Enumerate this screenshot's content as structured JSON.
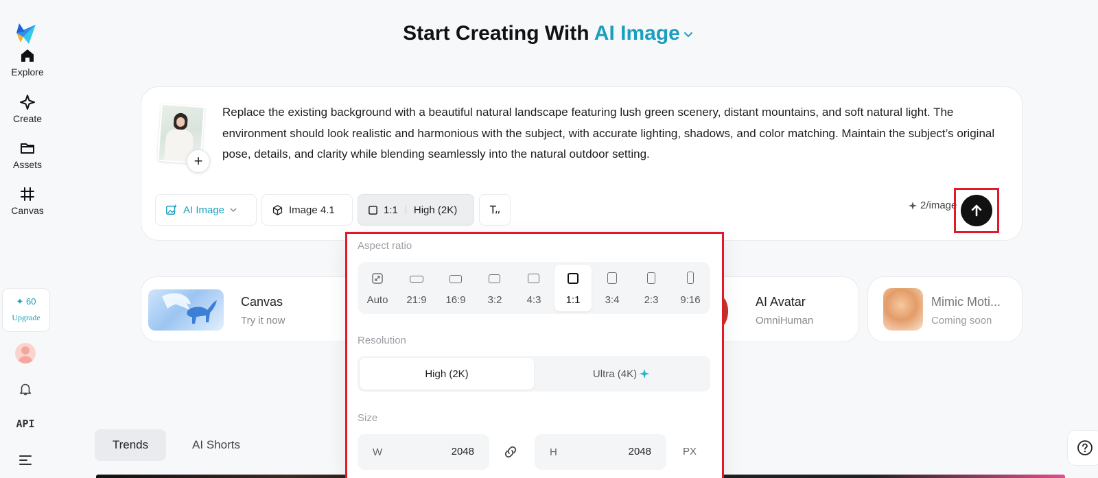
{
  "sidebar": {
    "items": [
      {
        "label": "Explore",
        "icon": "home-icon"
      },
      {
        "label": "Create",
        "icon": "sparkle-icon"
      },
      {
        "label": "Assets",
        "icon": "folder-icon"
      },
      {
        "label": "Canvas",
        "icon": "crop-icon"
      }
    ],
    "credits": "✦ 60",
    "upgrade": "Upgrade",
    "api": "API"
  },
  "header": {
    "title": "Start Creating With",
    "mode": "AI Image"
  },
  "prompt": {
    "text": "Replace the existing background with a beautiful natural landscape featuring lush green scenery, distant mountains, and soft natural light. The environment should look realistic and harmonious with the subject, with accurate lighting, shadows, and color matching. Maintain the subject’s original pose, details, and clarity while blending seamlessly into the natural outdoor setting.",
    "add_symbol": "+"
  },
  "toolbar": {
    "mode": "AI Image",
    "model": "Image 4.1",
    "ratio": "1:1",
    "quality": "High (2K)",
    "cost": "2/image"
  },
  "features": [
    {
      "title": "Canvas",
      "subtitle": "Try it now"
    },
    {
      "title": "AI Avatar",
      "subtitle": "OmniHuman"
    },
    {
      "title": "Mimic Moti...",
      "subtitle": "Coming soon"
    }
  ],
  "tabs": [
    "Trends",
    "AI Shorts"
  ],
  "panel": {
    "aspect_label": "Aspect ratio",
    "ratios": [
      "Auto",
      "21:9",
      "16:9",
      "3:2",
      "4:3",
      "1:1",
      "3:4",
      "2:3",
      "9:16"
    ],
    "selected_ratio": "1:1",
    "resolution_label": "Resolution",
    "resolutions": [
      "High (2K)",
      "Ultra (4K)"
    ],
    "selected_resolution": "High (2K)",
    "size_label": "Size",
    "width_label": "W",
    "width": "2048",
    "height_label": "H",
    "height": "2048",
    "unit": "PX"
  },
  "colors": {
    "accent": "#1a9fbf",
    "highlight": "#e0192b"
  }
}
